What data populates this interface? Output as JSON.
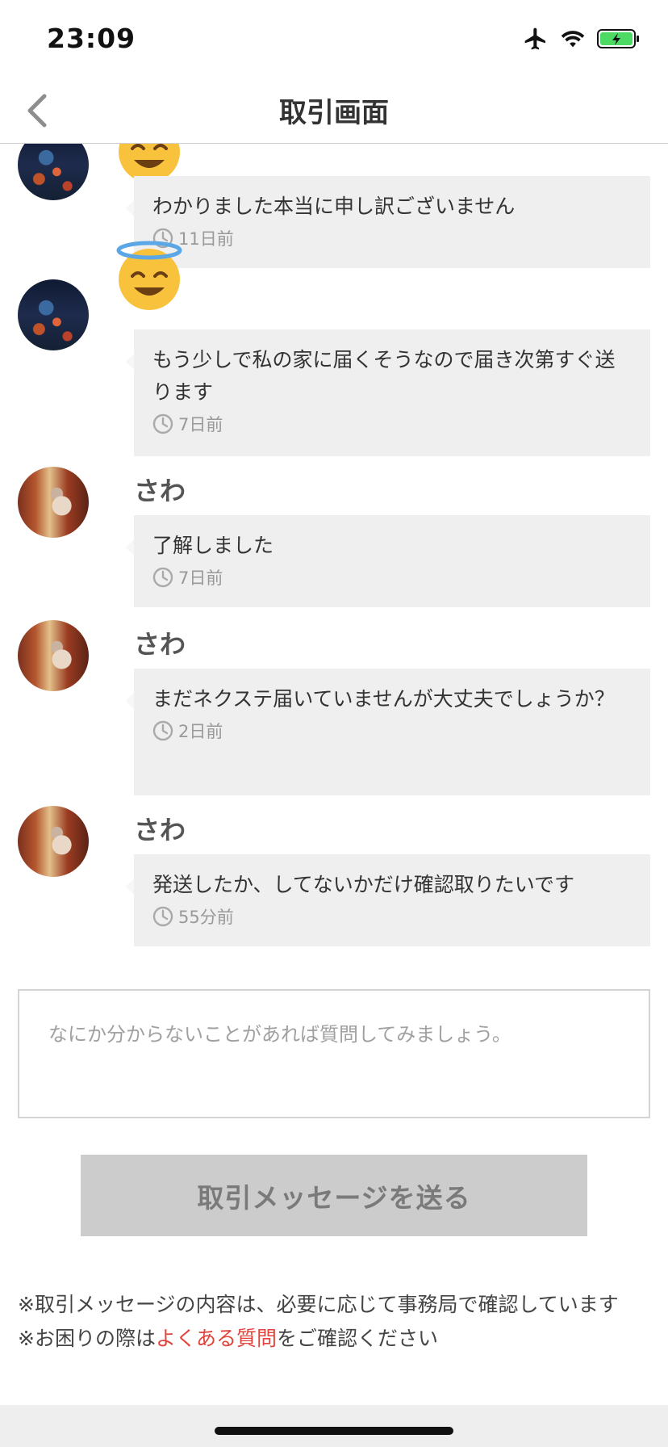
{
  "status_bar": {
    "time": "23:09",
    "icons": [
      "airplane-icon",
      "wifi-icon",
      "battery-charging-icon"
    ],
    "battery_color": "#4cd964"
  },
  "nav": {
    "back_icon": "chevron-left-icon",
    "title": "取引画面"
  },
  "messages": [
    {
      "sender": "",
      "avatar": "night-lanterns",
      "badge": "smiling-face-with-halo-emoji",
      "text": "わかりました本当に申し訳ございません",
      "time": "11日前"
    },
    {
      "sender": "",
      "avatar": "night-lanterns",
      "badge": "smiling-face-with-halo-emoji",
      "text": "もう少しで私の家に届くそうなので届き次第すぐ送ります",
      "time": "7日前"
    },
    {
      "sender": "さわ",
      "avatar": "person-photo",
      "text": "了解しました",
      "time": "7日前"
    },
    {
      "sender": "さわ",
      "avatar": "person-photo",
      "text": "まだネクステ届いていませんが大丈夫でしょうか？",
      "time": "2日前"
    },
    {
      "sender": "さわ",
      "avatar": "person-photo",
      "text": "発送したか、してないかだけ確認取りたいです",
      "time": "55分前"
    }
  ],
  "input": {
    "placeholder": "なにか分からないことがあれば質問してみましょう。",
    "value": ""
  },
  "send_button": {
    "label": "取引メッセージを送る"
  },
  "notes": {
    "line1": "※取引メッセージの内容は、必要に応じて事務局で確認しています",
    "line2_prefix": "※お困りの際は",
    "faq_link": "よくある質問",
    "line2_suffix": "をご確認ください",
    "link_color": "#e0443c"
  }
}
